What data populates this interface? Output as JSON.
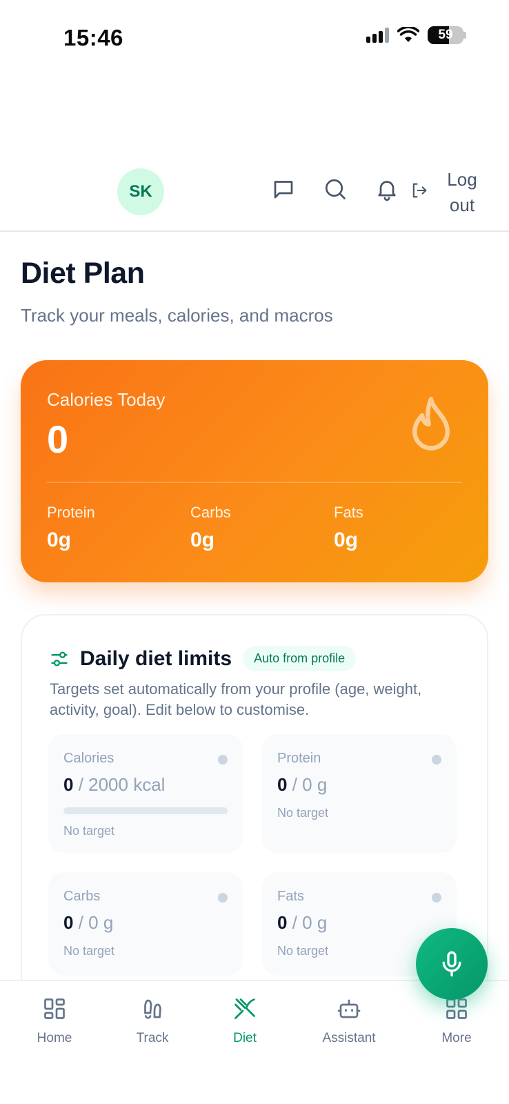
{
  "status_bar": {
    "time": "15:46",
    "battery": "59"
  },
  "header": {
    "avatar_initials": "SK",
    "icons": [
      "message-icon",
      "search-icon",
      "bell-icon",
      "logout-icon"
    ],
    "logout_label": "Log out"
  },
  "page": {
    "title": "Diet Plan",
    "subtitle": "Track your meals, calories, and macros"
  },
  "calories_card": {
    "label": "Calories Today",
    "value": "0",
    "macros": [
      {
        "label": "Protein",
        "value": "0g"
      },
      {
        "label": "Carbs",
        "value": "0g"
      },
      {
        "label": "Fats",
        "value": "0g"
      }
    ]
  },
  "limits": {
    "title": "Daily diet limits",
    "badge": "Auto from profile",
    "description": "Targets set automatically from your profile (age, weight, activity, goal). Edit below to customise.",
    "tiles": [
      {
        "label": "Calories",
        "current": "0",
        "target": " / 2000 kcal",
        "note": "No target",
        "progress": 0
      },
      {
        "label": "Protein",
        "current": "0",
        "target": " / 0 g",
        "note": "No target"
      },
      {
        "label": "Carbs",
        "current": "0",
        "target": " / 0 g",
        "note": "No target"
      },
      {
        "label": "Fats",
        "current": "0",
        "target": " / 0 g",
        "note": "No target"
      }
    ]
  },
  "bottom_nav": {
    "tabs": [
      {
        "label": "Home",
        "icon": "home-grid-icon"
      },
      {
        "label": "Track",
        "icon": "footprints-icon"
      },
      {
        "label": "Diet",
        "icon": "utensils-icon",
        "active": true
      },
      {
        "label": "Assistant",
        "icon": "bot-icon"
      },
      {
        "label": "More",
        "icon": "more-grid-icon"
      }
    ]
  },
  "colors": {
    "accent": "#059669",
    "orange": "#f97316",
    "avatar_bg": "#d1fae5"
  }
}
